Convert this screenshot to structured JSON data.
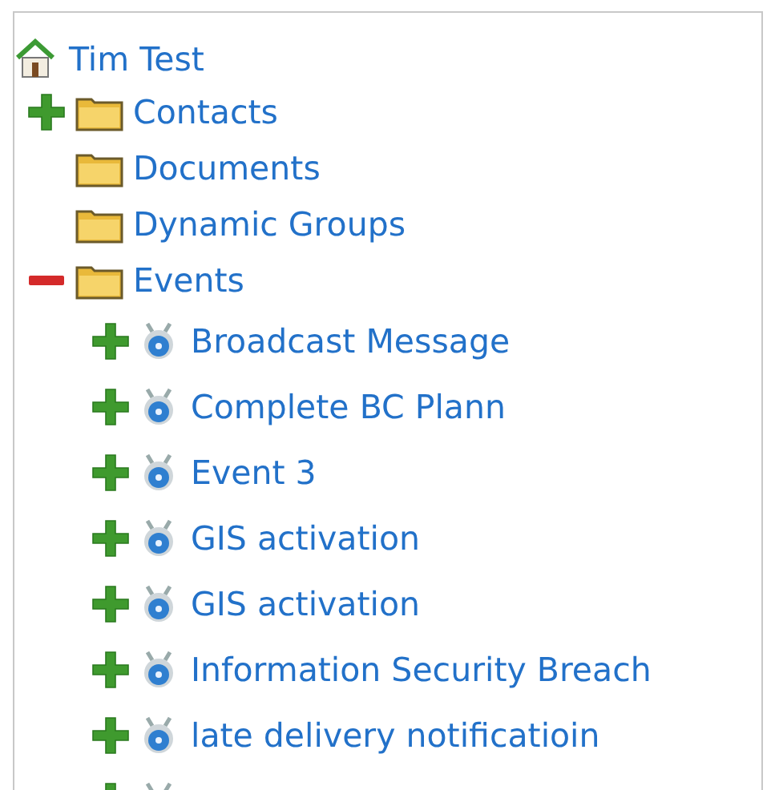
{
  "tree": {
    "label": "Tim Test",
    "children": [
      {
        "label": "Contacts",
        "kind": "folder",
        "has_children": true,
        "expanded": false
      },
      {
        "label": "Documents",
        "kind": "folder",
        "has_children": false
      },
      {
        "label": "Dynamic Groups",
        "kind": "folder",
        "has_children": false
      },
      {
        "label": "Events",
        "kind": "folder",
        "has_children": true,
        "expanded": true,
        "children": [
          {
            "label": "Broadcast Message",
            "kind": "event",
            "has_children": true,
            "expanded": false
          },
          {
            "label": "Complete BC Plann",
            "kind": "event",
            "has_children": true,
            "expanded": false
          },
          {
            "label": "Event 3",
            "kind": "event",
            "has_children": true,
            "expanded": false
          },
          {
            "label": "GIS activation",
            "kind": "event",
            "has_children": true,
            "expanded": false
          },
          {
            "label": "GIS activation",
            "kind": "event",
            "has_children": true,
            "expanded": false
          },
          {
            "label": "Information Security Breach",
            "kind": "event",
            "has_children": true,
            "expanded": false
          },
          {
            "label": "late delivery notificatioin",
            "kind": "event",
            "has_children": true,
            "expanded": false
          },
          {
            "kind": "event",
            "has_children": true,
            "expanded": false
          }
        ]
      }
    ]
  }
}
